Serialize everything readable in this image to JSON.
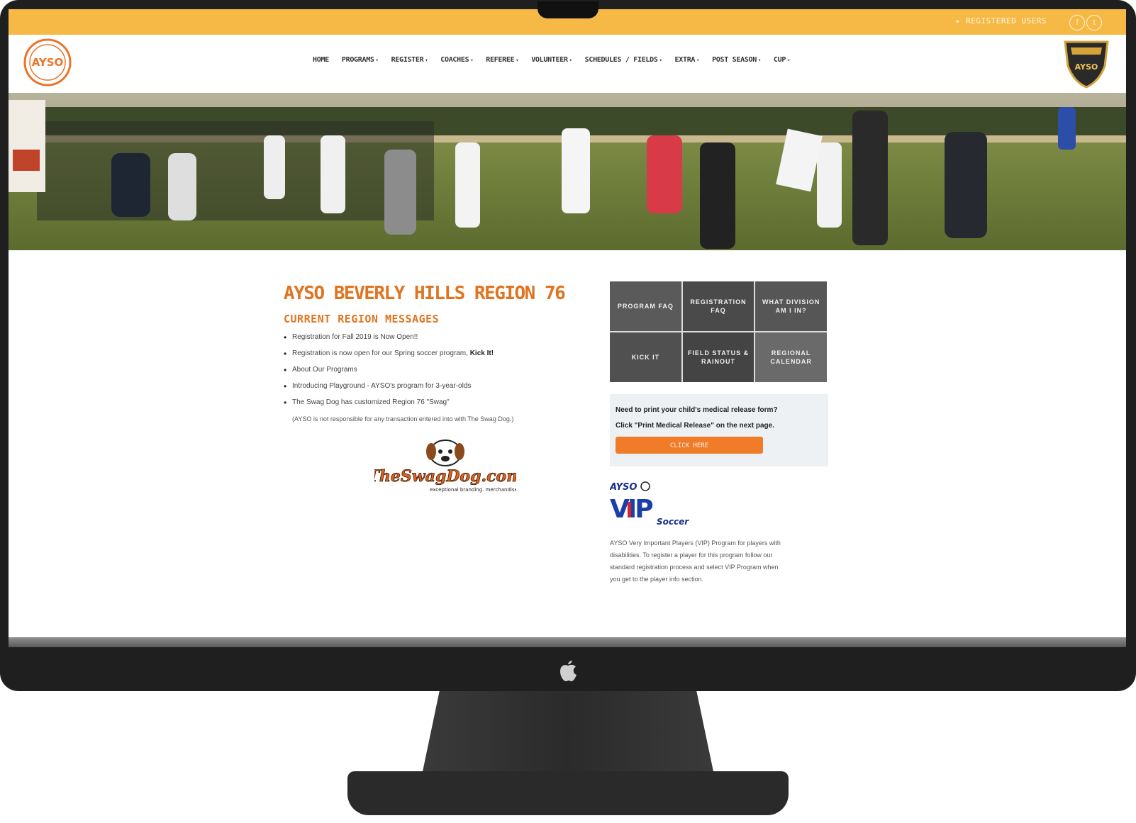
{
  "topbar": {
    "registered_users": "▸ REGISTERED USERS",
    "social": [
      {
        "icon": "facebook-icon",
        "glyph": "f"
      },
      {
        "icon": "twitter-icon",
        "glyph": "t"
      }
    ]
  },
  "nav": [
    {
      "label": "HOME",
      "has_caret": false
    },
    {
      "label": "PROGRAMS",
      "has_caret": true
    },
    {
      "label": "REGISTER",
      "has_caret": true
    },
    {
      "label": "COACHES",
      "has_caret": true
    },
    {
      "label": "REFEREE",
      "has_caret": true
    },
    {
      "label": "VOLUNTEER",
      "has_caret": true
    },
    {
      "label": "SCHEDULES / FIELDS",
      "has_caret": true
    },
    {
      "label": "EXTRA",
      "has_caret": true
    },
    {
      "label": "POST SEASON",
      "has_caret": true
    },
    {
      "label": "CUP",
      "has_caret": true
    }
  ],
  "nav_caret": "▾",
  "main": {
    "title": "AYSO BEVERLY HILLS REGION 76",
    "messages_title": "CURRENT REGION MESSAGES",
    "messages": [
      {
        "text": "Registration for Fall 2019 is Now Open!!",
        "bold": ""
      },
      {
        "text": "Registration is now open for our Spring soccer program, ",
        "bold": "Kick It!"
      },
      {
        "text": "About Our Programs",
        "bold": ""
      },
      {
        "text": "Introducing Playground - AYSO's program for 3-year-olds",
        "bold": ""
      },
      {
        "text": "The Swag Dog has customized Region 76 \"Swag\"",
        "bold": ""
      }
    ],
    "disclaimer": "(AYSO is not responsible for any transaction entered into with The Swag Dog.)",
    "swag_logo": {
      "name": "TheSwagDog.com",
      "tagline": "exceptional branding. merchandise"
    }
  },
  "tiles": [
    {
      "label": "PROGRAM FAQ",
      "bg": "#5a5a5a"
    },
    {
      "label": "REGISTRATION FAQ",
      "bg": "#4a4a4a"
    },
    {
      "label": "WHAT DIVISION AM I IN?",
      "bg": "#565656"
    },
    {
      "label": "KICK IT",
      "bg": "#505050"
    },
    {
      "label": "FIELD STATUS & RAINOUT",
      "bg": "#444444"
    },
    {
      "label": "REGIONAL CALENDAR",
      "bg": "#6a6a6a"
    }
  ],
  "medical": {
    "line1": "Need to print your child's medical release form?",
    "line2": "Click \"Print Medical Release\" on the next page.",
    "button": "CLICK HERE"
  },
  "vip": {
    "logo_top": "AYSO",
    "logo_main": "VIP",
    "logo_sub": "Soccer",
    "line1": "AYSO Very Important Players (VIP) Program for players with",
    "line2": "disabilities. To register a player for this program follow our",
    "line3": "standard registration process and select VIP Program when",
    "line4": "you get to the player info section."
  },
  "logo": {
    "text": "AYSO"
  },
  "crest": {
    "text": "AYSO"
  },
  "colors": {
    "accent": "#e07420",
    "topbar": "#f7b946",
    "button": "#f07c2a"
  }
}
